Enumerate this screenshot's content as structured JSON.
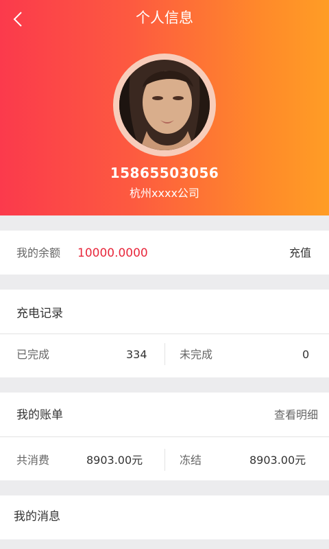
{
  "header": {
    "title": "个人信息",
    "back_icon": "chevron-left-icon",
    "phone": "15865503056",
    "company": "杭州xxxx公司"
  },
  "balance": {
    "label": "我的余额",
    "amount": "10000.0000",
    "recharge_label": "充值"
  },
  "charge_records": {
    "title": "充电记录",
    "completed_label": "已完成",
    "completed_value": "334",
    "pending_label": "未完成",
    "pending_value": "0"
  },
  "bill": {
    "title": "我的账单",
    "detail_link": "查看明细",
    "total_label": "共消费",
    "total_value": "8903.00元",
    "frozen_label": "冻结",
    "frozen_value": "8903.00元"
  },
  "messages": {
    "title": "我的消息"
  },
  "colors": {
    "gradient_start": "#fb3a4c",
    "gradient_end": "#ff9d25",
    "amount_red": "#e8283c"
  }
}
